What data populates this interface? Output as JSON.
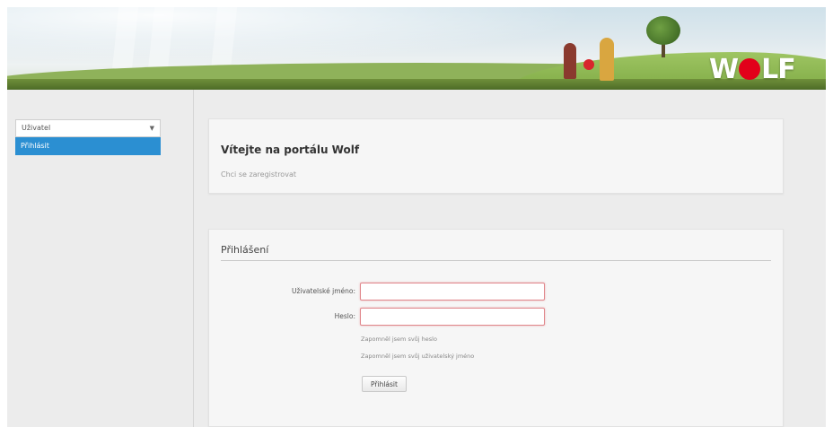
{
  "banner": {
    "logo_text_left": "W",
    "logo_text_right": "LF",
    "logo_full": "WOLF"
  },
  "sidebar": {
    "menu_select": "Uživatel",
    "active_item": "Přihlásit"
  },
  "welcome": {
    "title": "Vítejte na portálu Wolf",
    "subtitle": "Chci se zaregistrovat"
  },
  "login": {
    "title": "Přihlášení",
    "username_label": "Uživatelské jméno:",
    "password_label": "Heslo:",
    "forgot_password": "Zapomněl jsem svůj heslo",
    "forgot_username": "Zapomněl jsem svůj uživatelský jméno",
    "submit": "Přihlásit"
  },
  "colors": {
    "accent": "#2b8fd2",
    "brand": "#e2001a",
    "input_error_border": "#e0868b"
  }
}
